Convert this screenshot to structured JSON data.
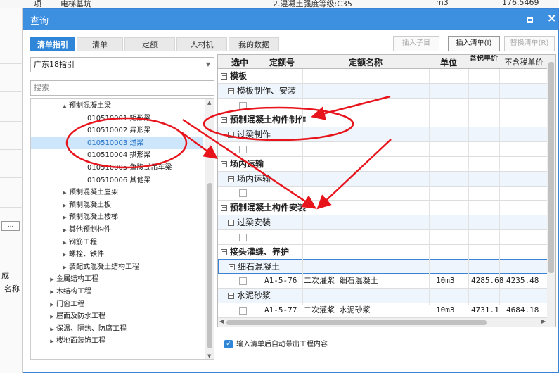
{
  "background": {
    "top_row": [
      "项",
      "电梯基坑",
      "2.混凝土强度等级:C35",
      "m3",
      "176.5469"
    ],
    "left_text": [
      "...",
      "成",
      "名称"
    ]
  },
  "dialog": {
    "title": "查询",
    "maximize_icon": "maximize-icon",
    "close_icon": "×",
    "tabs": [
      "清单指引",
      "清单",
      "定额",
      "人材机",
      "我的数据"
    ],
    "active_tab": "清单指引",
    "buttons": {
      "insert_sub": "插入子目",
      "insert_list": "插入清单(I)",
      "replace_list": "替换清单(R)"
    },
    "left": {
      "guide_select": "广东18指引",
      "search_placeholder": "搜索",
      "tree": [
        {
          "text": "预制混凝土梁",
          "level": 2,
          "caret": "▲"
        },
        {
          "text": "010510001  矩形梁",
          "level": 3
        },
        {
          "text": "010510002  异形梁",
          "level": 3
        },
        {
          "text": "010510003  过梁",
          "level": 3,
          "selected": true
        },
        {
          "text": "010510004  拱形梁",
          "level": 3
        },
        {
          "text": "010510005  鱼腹式吊车梁",
          "level": 3
        },
        {
          "text": "010510006  其他梁",
          "level": 3
        },
        {
          "text": "预制混凝土屋架",
          "level": 2,
          "caret": "▶"
        },
        {
          "text": "预制混凝土板",
          "level": 2,
          "caret": "▶"
        },
        {
          "text": "预制混凝土楼梯",
          "level": 2,
          "caret": "▶"
        },
        {
          "text": "其他预制构件",
          "level": 2,
          "caret": "▶"
        },
        {
          "text": "钢筋工程",
          "level": 2,
          "caret": "▶"
        },
        {
          "text": "螺栓、铁件",
          "level": 2,
          "caret": "▶"
        },
        {
          "text": "装配式混凝土结构工程",
          "level": 2,
          "caret": "▶"
        },
        {
          "text": "金属结构工程",
          "level": 1,
          "caret": "▶"
        },
        {
          "text": "木结构工程",
          "level": 1,
          "caret": "▶"
        },
        {
          "text": "门窗工程",
          "level": 1,
          "caret": "▶"
        },
        {
          "text": "屋面及防水工程",
          "level": 1,
          "caret": "▶"
        },
        {
          "text": "保温、隔热、防腐工程",
          "level": 1,
          "caret": "▶"
        },
        {
          "text": "楼地面装饰工程",
          "level": 1,
          "caret": "▶"
        }
      ]
    },
    "grid": {
      "columns": [
        "选中",
        "定额号",
        "定额名称",
        "单位",
        "含税单价",
        "不含税单价"
      ],
      "rows": [
        {
          "kind": "grp",
          "text": "模板",
          "toggle": "−"
        },
        {
          "kind": "sub",
          "text": "模板制作、安装",
          "toggle": "−"
        },
        {
          "kind": "empty"
        },
        {
          "kind": "grp",
          "text": "预制混凝土构件制作",
          "toggle": "−"
        },
        {
          "kind": "sub",
          "text": "过梁制作",
          "toggle": "−"
        },
        {
          "kind": "empty"
        },
        {
          "kind": "grp",
          "text": "场内运输",
          "toggle": "−"
        },
        {
          "kind": "sub",
          "text": "场内运输",
          "toggle": "−"
        },
        {
          "kind": "empty"
        },
        {
          "kind": "grp",
          "text": "预制混凝土构件安装",
          "toggle": "−"
        },
        {
          "kind": "sub",
          "text": "过梁安装",
          "toggle": "−"
        },
        {
          "kind": "empty"
        },
        {
          "kind": "grp",
          "text": "接头灌缝、养护",
          "toggle": "−"
        },
        {
          "kind": "sub",
          "text": "细石混凝土",
          "toggle": "−",
          "highlight": true
        },
        {
          "kind": "item",
          "code": "A1-5-76",
          "name": "二次灌浆 细石混凝土",
          "unit": "10m3",
          "price_tax": "4285.68",
          "price_notax": "4235.48"
        },
        {
          "kind": "sub",
          "text": "水泥砂浆",
          "toggle": "−"
        },
        {
          "kind": "item",
          "code": "A1-5-77",
          "name": "二次灌浆 水泥砂浆",
          "unit": "10m3",
          "price_tax": "4731.1",
          "price_notax": "4684.18"
        }
      ]
    },
    "footer_checkbox": "输入清单后自动带出工程内容",
    "footer_checked": "✓"
  },
  "annotation_color": "#e8141c"
}
